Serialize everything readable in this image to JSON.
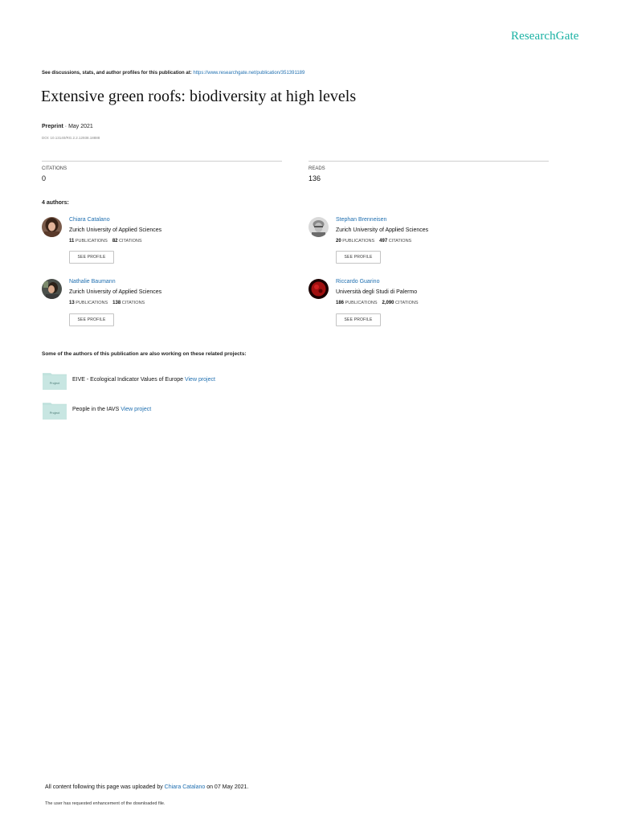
{
  "brand": "ResearchGate",
  "discussion": {
    "text": "See discussions, stats, and author profiles for this publication at: ",
    "link": "https://www.researchgate.net/publication/351391189"
  },
  "title": "Extensive green roofs: biodiversity at high levels",
  "publication_type": "Preprint",
  "publication_date": " · May 2021",
  "doi": "DOI: 10.13140/RG.2.2.12938.18888",
  "stats": {
    "citations_label": "CITATIONS",
    "citations_value": "0",
    "reads_label": "READS",
    "reads_value": "136"
  },
  "authors_heading": "4 authors:",
  "authors": [
    {
      "name": "Chiara Catalano",
      "institution": "Zurich University of Applied Sciences",
      "publications": "11",
      "publications_label": "PUBLICATIONS",
      "citations": "82",
      "citations_label": "CITATIONS",
      "button": "SEE PROFILE"
    },
    {
      "name": "Stephan Brenneisen",
      "institution": "Zurich University of Applied Sciences",
      "publications": "20",
      "publications_label": "PUBLICATIONS",
      "citations": "497",
      "citations_label": "CITATIONS",
      "button": "SEE PROFILE"
    },
    {
      "name": "Nathalie Baumann",
      "institution": "Zurich University of Applied Sciences",
      "publications": "13",
      "publications_label": "PUBLICATIONS",
      "citations": "138",
      "citations_label": "CITATIONS",
      "button": "SEE PROFILE"
    },
    {
      "name": "Riccardo Guarino",
      "institution": "Università degli Studi di Palermo",
      "publications": "186",
      "publications_label": "PUBLICATIONS",
      "citations": "2,090",
      "citations_label": "CITATIONS",
      "button": "SEE PROFILE"
    }
  ],
  "related_heading": "Some of the authors of this publication are also working on these related projects:",
  "projects": [
    {
      "icon_label": "Project",
      "name": "EIVE - Ecological Indicator Values of Europe ",
      "link": "View project"
    },
    {
      "icon_label": "Project",
      "name": "People in the IAVS ",
      "link": "View project"
    }
  ],
  "footer": {
    "uploaded_prefix": "All content following this page was uploaded by ",
    "uploader": "Chiara Catalano",
    "uploaded_suffix": " on 07 May 2021.",
    "note": "The user has requested enhancement of the downloaded file."
  },
  "colors": {
    "brand": "#19b1a3",
    "link": "#1f6fb0",
    "project_icon": "#c8e6e2"
  }
}
